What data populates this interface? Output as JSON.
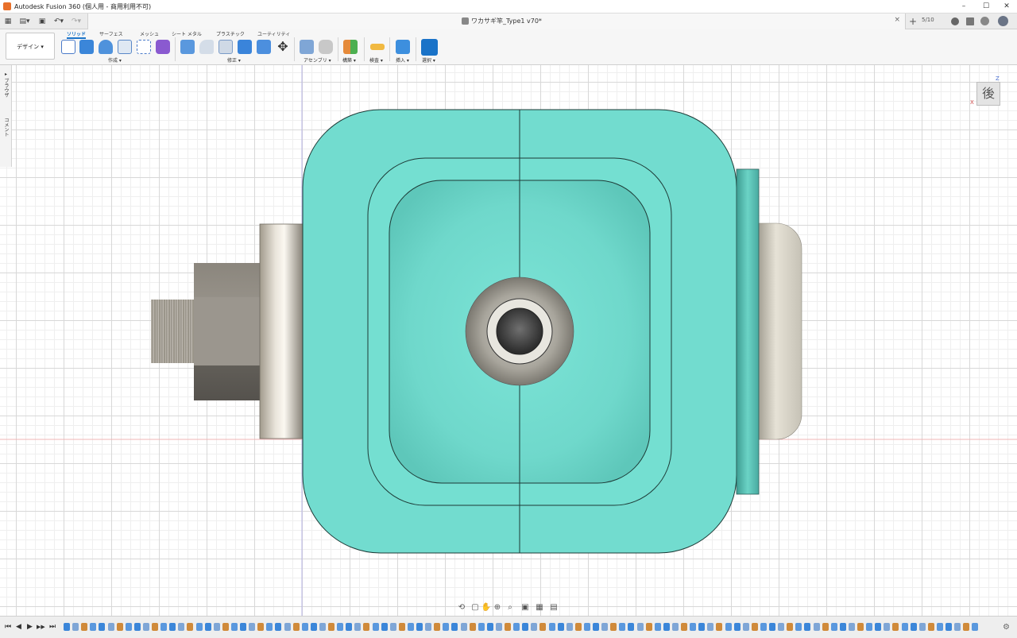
{
  "window": {
    "title": "Autodesk Fusion 360 (個人用 - 商用利用不可)",
    "minimize": "–",
    "maximize": "☐",
    "close": "✕"
  },
  "tabbar": {
    "grid_icon": "grid-icon",
    "file_icon": "file-icon",
    "save_icon": "save-icon",
    "undo_icon": "undo-icon",
    "redo_icon": "redo-icon",
    "document_title": "ワカサギ竿_Type1 v70*",
    "close_tab": "×",
    "new_tab": "+",
    "jobs": "5/10"
  },
  "toolbar": {
    "workspace_label": "デザイン ▾",
    "tabs": [
      {
        "label": "ソリッド",
        "active": true
      },
      {
        "label": "サーフェス",
        "active": false
      },
      {
        "label": "メッシュ",
        "active": false
      },
      {
        "label": "シート メタル",
        "active": false
      },
      {
        "label": "プラスチック",
        "active": false
      },
      {
        "label": "ユーティリティ",
        "active": false
      }
    ],
    "groups": [
      {
        "label": "作成 ▾"
      },
      {
        "label": "修正 ▾"
      },
      {
        "label": "アセンブリ ▾"
      },
      {
        "label": "構築 ▾"
      },
      {
        "label": "検査 ▾"
      },
      {
        "label": "挿入 ▾"
      },
      {
        "label": "選択 ▾"
      }
    ]
  },
  "browser": {
    "browser_label": "▸ ブラウザ",
    "comment_label": "コメント"
  },
  "viewcube": {
    "face_label": "後",
    "axis_z": "Z",
    "axis_x": "X"
  },
  "colors": {
    "body": "#72dccf",
    "accent": "#1a73c8",
    "metal": "#b5b0a6"
  },
  "timeline": {
    "first": "⏮",
    "prev": "◀",
    "play": "▶",
    "next": "▶▶",
    "last": "⏭",
    "settings": "⚙"
  }
}
